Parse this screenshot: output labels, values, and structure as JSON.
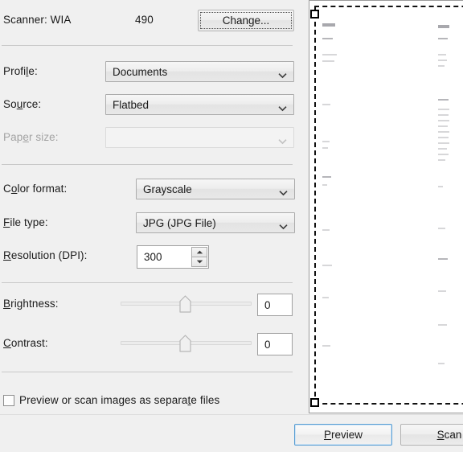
{
  "dialog": {
    "scanner": {
      "label": "Scanner: WIA",
      "value": "490",
      "change_button": "Change..."
    },
    "fields": [
      {
        "label": "Profile:",
        "mnemonic": "l",
        "value": "Documents",
        "control": "combobox",
        "disabled": false
      },
      {
        "label": "Source:",
        "mnemonic": "u",
        "value": "Flatbed",
        "control": "combobox",
        "disabled": false
      },
      {
        "label": "Paper size:",
        "mnemonic": "r",
        "value": "",
        "control": "combobox",
        "disabled": true
      },
      {
        "label": "Color format:",
        "mnemonic": "o",
        "value": "Grayscale",
        "control": "combobox",
        "disabled": false
      },
      {
        "label": "File type:",
        "mnemonic": "F",
        "value": "JPG (JPG File)",
        "control": "combobox",
        "disabled": false
      },
      {
        "label": "Resolution (DPI):",
        "mnemonic": "R",
        "value": "300",
        "control": "spinner",
        "disabled": false
      }
    ],
    "sliders": [
      {
        "label": "Brightness:",
        "mnemonic": "B",
        "value": "0",
        "position_pct": 50
      },
      {
        "label": "Contrast:",
        "mnemonic": "C",
        "value": "0",
        "position_pct": 50
      }
    ],
    "checkbox": {
      "label": "Preview or scan images as separate files",
      "mnemonic": "t",
      "checked": false
    },
    "buttons": {
      "preview": "Preview",
      "preview_mnemonic": "P",
      "scan": "Scan",
      "scan_mnemonic": "S"
    }
  },
  "preview": {
    "selection": {
      "dashed": true,
      "handles": 2
    }
  },
  "colors": {
    "dialog_background": "#f0f0f0",
    "text": "#1a1a1a",
    "disabled_text": "#a3a3a3",
    "control_border": "#acacac",
    "separator": "#c8c8c8",
    "default_button_border": "#5a9fd4",
    "field_background": "#ffffff",
    "marquee": "#111111"
  }
}
